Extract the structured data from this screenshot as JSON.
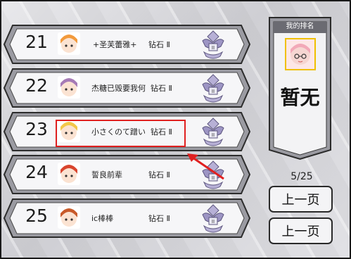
{
  "ranking": [
    {
      "rank": "21",
      "name": "+圣芙蕾雅+",
      "tier": "钻石 Ⅱ",
      "avatar_color": "#f29a3c"
    },
    {
      "rank": "22",
      "name": "杰糖已毁要我何",
      "tier": "钻石 Ⅱ",
      "avatar_color": "#a67bb6"
    },
    {
      "rank": "23",
      "name": "小さくのて蹭い",
      "tier": "钻石 Ⅱ",
      "avatar_color": "#f2c84a"
    },
    {
      "rank": "24",
      "name": "誓良前辈",
      "tier": "钻石 Ⅱ",
      "avatar_color": "#d9452e"
    },
    {
      "rank": "25",
      "name": "ic棒棒",
      "tier": "钻石 Ⅱ",
      "avatar_color": "#c85a2a"
    }
  ],
  "my_rank": {
    "title": "我的排名",
    "status": "暂无"
  },
  "pagination": {
    "page_indicator": "5/25",
    "prev_label": "上一页",
    "next_label": "上一页"
  },
  "colors": {
    "highlight": "#e02020",
    "banner_fill": "#f5f5f7",
    "banner_border": "#3a3a3a",
    "emblem": "#8a7fb0"
  }
}
